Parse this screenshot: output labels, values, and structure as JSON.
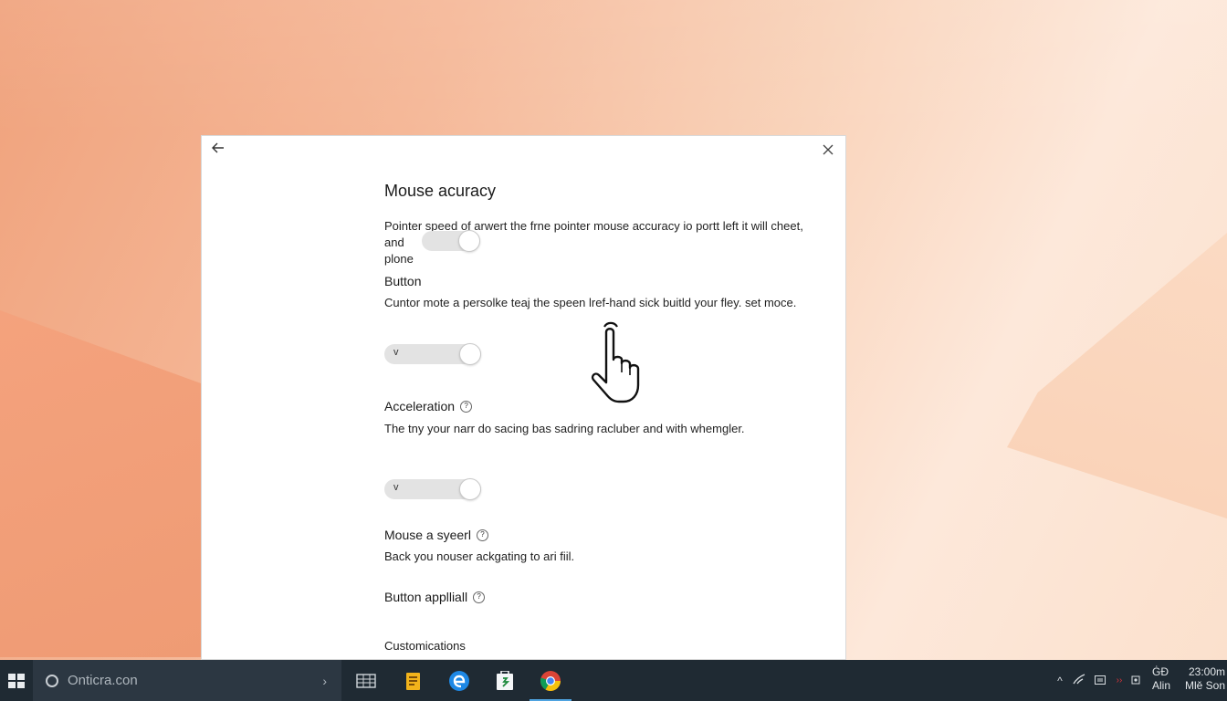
{
  "window": {
    "back_icon": "back-arrow-icon",
    "close_icon": "close-icon"
  },
  "page": {
    "title": "Mouse acuracy",
    "intro": "Pointer speed of arwert the frne pointer mouse accuracy io portt left it will cheet, and",
    "intro_tail": "plone"
  },
  "sections": [
    {
      "heading": "Button",
      "description": "Cuntor mote a persolke teaj the speen lref-hand sick buitld your fley. set moce.",
      "toggle_glyph": "v",
      "has_info": false
    },
    {
      "heading": "Acceleration",
      "description": "The tny your narr do sacing bas sadring racluber and with whemgler.",
      "toggle_glyph": "v",
      "has_info": true
    },
    {
      "heading": "Mouse a syeerl",
      "description": "Back you nouser ackgating to ari fiil.",
      "has_info": true
    },
    {
      "heading": "Button applliall",
      "has_info": true
    },
    {
      "heading": "Customications"
    }
  ],
  "taskbar": {
    "search_placeholder": "Onticra.con",
    "apps": [
      "task-view-icon",
      "file-explorer-icon",
      "edge-icon",
      "store-icon",
      "chrome-icon"
    ],
    "active_app": "chrome-icon",
    "tray": {
      "lang_top": "ĠĐ",
      "lang_bottom": "Alin",
      "time": "23:00m",
      "date": "Mlě Son"
    }
  },
  "colors": {
    "taskbar": "#1f2a33",
    "search": "#2c3742",
    "toggle_track": "#e3e3e3",
    "active_indicator": "#4fa3e0"
  }
}
